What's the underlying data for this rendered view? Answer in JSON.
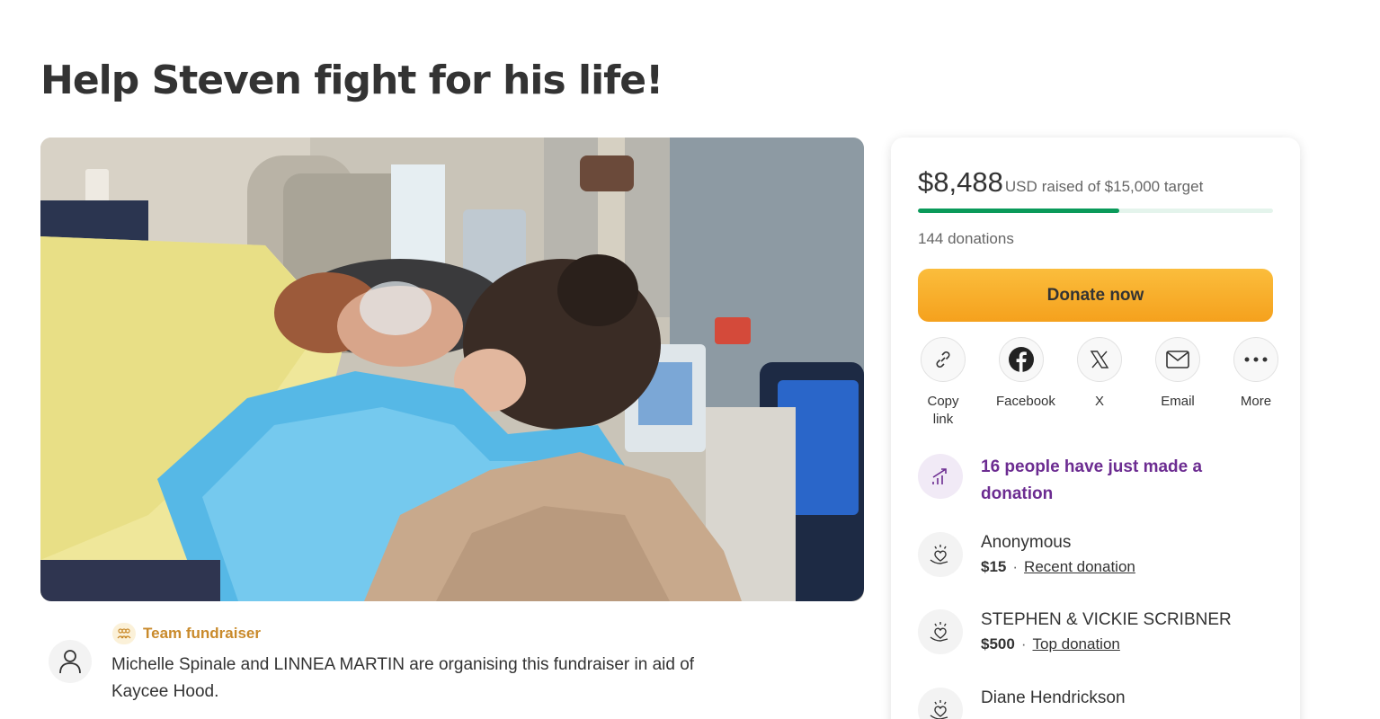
{
  "page": {
    "title": "Help Steven fight for his life!"
  },
  "organiser": {
    "team_label": "Team fundraiser",
    "text": "Michelle Spinale and LINNEA MARTIN are organising this fundraiser in aid of Kaycee Hood."
  },
  "progress": {
    "raised": "$8,488",
    "currency": "USD",
    "target_text": "raised of $15,000 target",
    "fraction": 0.566,
    "donation_count": "144 donations"
  },
  "donate_button": {
    "label": "Donate now"
  },
  "share": [
    {
      "label": "Copy link",
      "icon": "link-icon"
    },
    {
      "label": "Facebook",
      "icon": "facebook-icon"
    },
    {
      "label": "X",
      "icon": "x-logo-icon"
    },
    {
      "label": "Email",
      "icon": "email-icon"
    },
    {
      "label": "More",
      "icon": "more-icon"
    }
  ],
  "activity": {
    "text": "16 people have just made a donation"
  },
  "donors": [
    {
      "name": "Anonymous",
      "amount": "$15",
      "tag": "Recent donation"
    },
    {
      "name": "STEPHEN & VICKIE SCRIBNER",
      "amount": "$500",
      "tag": "Top donation"
    },
    {
      "name": "Diane Hendrickson",
      "amount": "",
      "tag": ""
    }
  ],
  "colors": {
    "accent_green": "#0a9a5a",
    "donate_orange": "#f5a11d",
    "activity_purple": "#6c2c91",
    "team_gold": "#c98a2b"
  }
}
